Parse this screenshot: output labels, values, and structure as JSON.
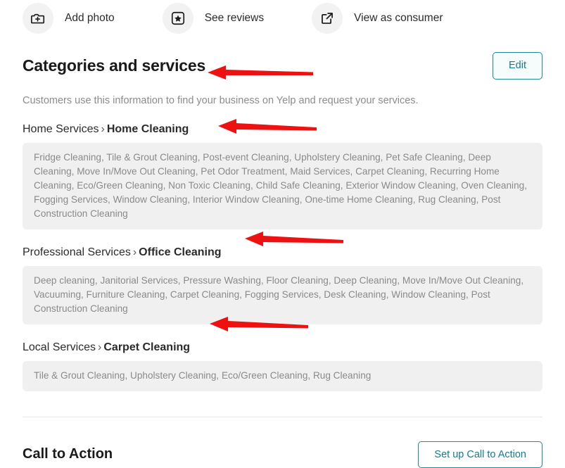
{
  "actionbar": {
    "items": [
      {
        "icon": "camera-plus-icon",
        "label": "Add photo"
      },
      {
        "icon": "star-square-icon",
        "label": "See reviews"
      },
      {
        "icon": "external-link-icon",
        "label": "View as consumer"
      }
    ]
  },
  "categories_section": {
    "title": "Categories and services",
    "edit_label": "Edit",
    "description": "Customers use this information to find your business on Yelp and request your services.",
    "groups": [
      {
        "parent": "Home Services",
        "separator": "›",
        "category": "Home Cleaning",
        "services": "Fridge Cleaning, Tile & Grout Cleaning, Post-event Cleaning, Upholstery Cleaning, Pet Safe Cleaning, Deep Cleaning, Move In/Move Out Cleaning, Pet Odor Treatment, Maid Services, Carpet Cleaning, Recurring Home Cleaning, Eco/Green Cleaning, Non Toxic Cleaning, Child Safe Cleaning, Exterior Window Cleaning, Oven Cleaning, Fogging Services, Window Cleaning, Interior Window Cleaning, One-time Home Cleaning, Rug Cleaning, Post Construction Cleaning"
      },
      {
        "parent": "Professional Services",
        "separator": "›",
        "category": "Office Cleaning",
        "services": "Deep cleaning, Janitorial Services, Pressure Washing, Floor Cleaning, Deep Cleaning, Move In/Move Out Cleaning, Vacuuming, Furniture Cleaning, Carpet Cleaning, Fogging Services, Desk Cleaning, Window Cleaning, Post Construction Cleaning"
      },
      {
        "parent": "Local Services",
        "separator": "›",
        "category": "Carpet Cleaning",
        "services": "Tile & Grout Cleaning, Upholstery Cleaning, Eco/Green Cleaning, Rug Cleaning"
      }
    ]
  },
  "cta_section": {
    "title": "Call to Action",
    "button_label": "Set up Call to Action"
  },
  "annotations": {
    "arrow_color": "#ee1111",
    "arrows": [
      {
        "name": "arrow-to-categories-title"
      },
      {
        "name": "arrow-to-home-cleaning"
      },
      {
        "name": "arrow-to-office-cleaning"
      },
      {
        "name": "arrow-to-carpet-cleaning"
      }
    ]
  },
  "colors": {
    "accent": "#1d8a96",
    "box_background": "#f0f0f0",
    "icon_background": "#f2f2f2"
  }
}
